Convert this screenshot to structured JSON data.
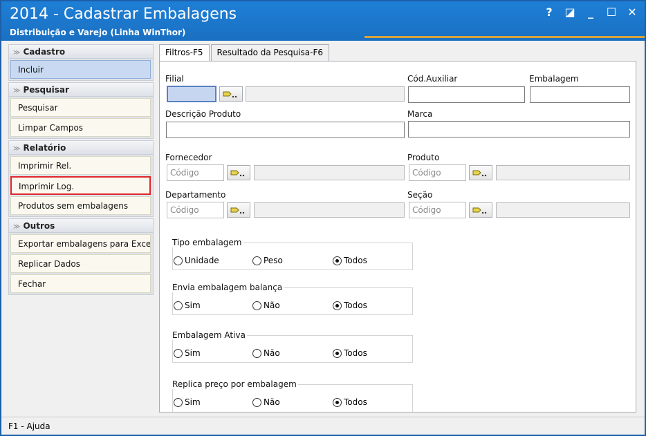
{
  "window": {
    "title": "2014 - Cadastrar Embalagens",
    "subtitle": "Distribuição e Varejo (Linha WinThor)",
    "controls": {
      "help": "?",
      "restore": "◪",
      "minimize": "_",
      "maximize": "☐",
      "close": "✕"
    }
  },
  "sidebar": {
    "groups": [
      {
        "title": "Cadastro",
        "items": [
          "Incluir"
        ]
      },
      {
        "title": "Pesquisar",
        "items": [
          "Pesquisar",
          "Limpar Campos"
        ]
      },
      {
        "title": "Relatório",
        "items": [
          "Imprimir Rel.",
          "Imprimir Log.",
          "Produtos sem embalagens"
        ]
      },
      {
        "title": "Outros",
        "items": [
          "Exportar embalagens para Excel",
          "Replicar Dados",
          "Fechar"
        ]
      }
    ]
  },
  "tabs": [
    "Filtros-F5",
    "Resultado da Pesquisa-F6"
  ],
  "form": {
    "filial_label": "Filial",
    "cod_auxiliar_label": "Cód.Auxiliar",
    "embalagem_label": "Embalagem",
    "descricao_label": "Descrição Produto",
    "marca_label": "Marca",
    "fornecedor_label": "Fornecedor",
    "produto_label": "Produto",
    "departamento_label": "Departamento",
    "secao_label": "Seção",
    "codigo_placeholder": "Código"
  },
  "radio_groups": [
    {
      "title": "Tipo embalagem",
      "options": [
        "Unidade",
        "Peso",
        "Todos"
      ],
      "selected": "Todos"
    },
    {
      "title": "Envia embalagem balança",
      "options": [
        "Sim",
        "Não",
        "Todos"
      ],
      "selected": "Todos"
    },
    {
      "title": "Embalagem Ativa",
      "options": [
        "Sim",
        "Não",
        "Todos"
      ],
      "selected": "Todos"
    },
    {
      "title": "Replica preço por embalagem",
      "options": [
        "Sim",
        "Não",
        "Todos"
      ],
      "selected": "Todos"
    }
  ],
  "status": {
    "help": "F1 - Ajuda"
  },
  "colors": {
    "titlebar": "#1a70c2",
    "highlight": "#e0252b",
    "active_item": "#c8d9f1"
  }
}
